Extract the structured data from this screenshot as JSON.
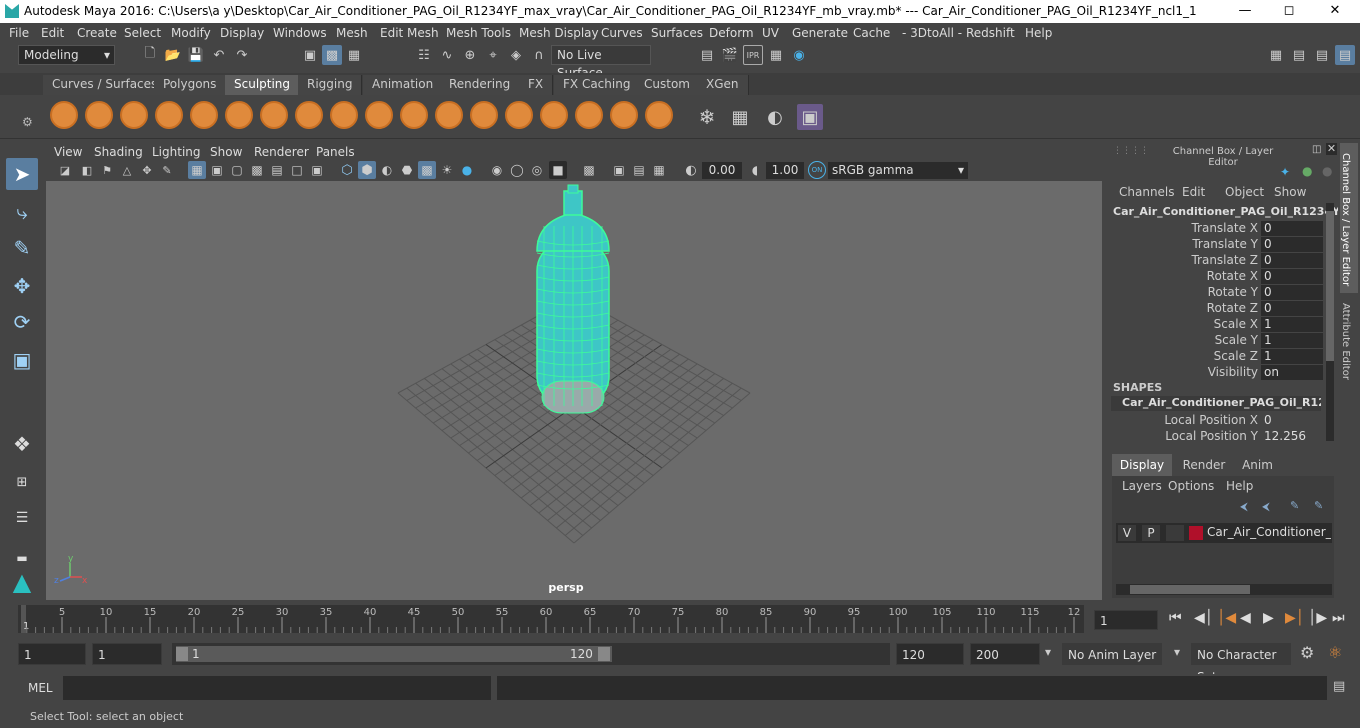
{
  "window": {
    "title": "Autodesk Maya 2016: C:\\Users\\a y\\Desktop\\Car_Air_Conditioner_PAG_Oil_R1234YF_max_vray\\Car_Air_Conditioner_PAG_Oil_R1234YF_mb_vray.mb*   ---   Car_Air_Conditioner_PAG_Oil_R1234YF_ncl1_1"
  },
  "menubar": [
    "File",
    "Edit",
    "Create",
    "Select",
    "Modify",
    "Display",
    "Windows",
    "Mesh",
    "Edit Mesh",
    "Mesh Tools",
    "Mesh Display",
    "Curves",
    "Surfaces",
    "Deform",
    "UV",
    "Generate",
    "Cache",
    "- 3DtoAll -",
    "Redshift",
    "Help"
  ],
  "status": {
    "mode": "Modeling",
    "live_surface": "No Live Surface"
  },
  "shelf_tabs": [
    "Curves / Surfaces",
    "Polygons",
    "Sculpting",
    "Rigging",
    "Animation",
    "Rendering",
    "FX",
    "FX Caching",
    "Custom",
    "XGen"
  ],
  "active_shelf_tab": "Sculpting",
  "viewport": {
    "menu": [
      "View",
      "Shading",
      "Lighting",
      "Show",
      "Renderer",
      "Panels"
    ],
    "exposure": "0.00",
    "gamma": "1.00",
    "color_space": "sRGB gamma",
    "camera_label": "persp",
    "wire_color": "#3dfc9a",
    "mesh_color": "#3ec6c6",
    "axis_y": "y",
    "axis_z": "z",
    "axis_x": "x"
  },
  "channel_box": {
    "title": "Channel Box / Layer Editor",
    "menu": [
      "Channels",
      "Edit",
      "Object",
      "Show"
    ],
    "object": "Car_Air_Conditioner_PAG_Oil_R1234Y...",
    "attrs": [
      {
        "name": "Translate X",
        "value": "0"
      },
      {
        "name": "Translate Y",
        "value": "0"
      },
      {
        "name": "Translate Z",
        "value": "0"
      },
      {
        "name": "Rotate X",
        "value": "0"
      },
      {
        "name": "Rotate Y",
        "value": "0"
      },
      {
        "name": "Rotate Z",
        "value": "0"
      },
      {
        "name": "Scale X",
        "value": "1"
      },
      {
        "name": "Scale Y",
        "value": "1"
      },
      {
        "name": "Scale Z",
        "value": "1"
      },
      {
        "name": "Visibility",
        "value": "on"
      }
    ],
    "shapes_label": "SHAPES",
    "shape_name": "Car_Air_Conditioner_PAG_Oil_R1234...",
    "shape_attrs": [
      {
        "name": "Local Position X",
        "value": "0"
      },
      {
        "name": "Local Position Y",
        "value": "12.256"
      }
    ]
  },
  "layer_editor": {
    "tabs": [
      "Display",
      "Render",
      "Anim"
    ],
    "menu": [
      "Layers",
      "Options",
      "Help"
    ],
    "layer": {
      "v": "V",
      "p": "P",
      "color": "#b0102a",
      "name": "Car_Air_Conditioner_PAG"
    }
  },
  "side_tabs": [
    "Channel Box / Layer Editor",
    "Attribute Editor"
  ],
  "timeline": {
    "ticks": [
      "5",
      "10",
      "15",
      "20",
      "25",
      "30",
      "35",
      "40",
      "45",
      "50",
      "55",
      "60",
      "65",
      "70",
      "75",
      "80",
      "85",
      "90",
      "95",
      "100",
      "105",
      "110",
      "115",
      "12"
    ],
    "start_marker": "1",
    "current_frame": "1"
  },
  "range": {
    "start": "1",
    "start2": "1",
    "slider_start": "1",
    "slider_end": "120",
    "end": "120",
    "end2": "200",
    "anim_layer": "No Anim Layer",
    "char_set": "No Character Set"
  },
  "mel": {
    "label": "MEL"
  },
  "help_line": "Select Tool: select an object"
}
